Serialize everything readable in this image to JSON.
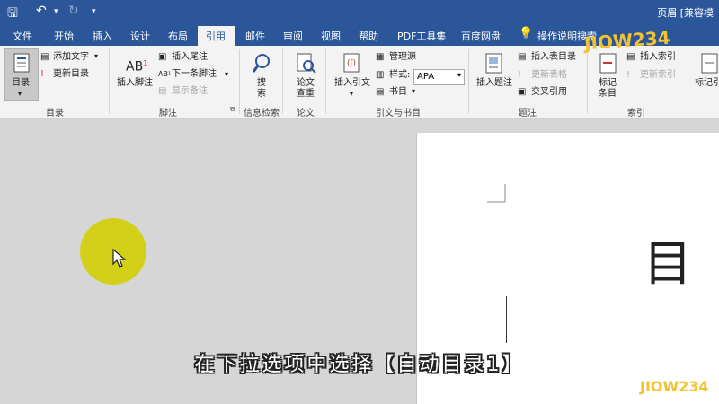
{
  "window": {
    "title": "页眉 [兼容模"
  },
  "tabs": [
    "文件",
    "开始",
    "插入",
    "设计",
    "布局",
    "引用",
    "邮件",
    "审阅",
    "视图",
    "帮助",
    "PDF工具集",
    "百度网盘"
  ],
  "active_tab": "引用",
  "tell_me": "操作说明搜索",
  "ribbon": {
    "toc": {
      "button": "目录",
      "add_text": "添加文字",
      "update": "更新目录",
      "group": "目录"
    },
    "footnotes": {
      "insert_footnote": "插入脚注",
      "insert_endnote": "插入尾注",
      "next_footnote": "下一条脚注",
      "show_notes": "显示备注",
      "group": "脚注"
    },
    "research": {
      "search": "搜索",
      "group": "信息检索"
    },
    "paper": {
      "check": "论文查重",
      "group": "论文"
    },
    "citations": {
      "insert_citation": "插入引文",
      "manage_sources": "管理源",
      "style_label": "样式:",
      "style_value": "APA",
      "bibliography": "书目",
      "group": "引文与书目"
    },
    "captions": {
      "insert_caption": "插入题注",
      "insert_table_figures": "插入表目录",
      "update_table": "更新表格",
      "cross_reference": "交叉引用",
      "group": "题注"
    },
    "index": {
      "mark_entry": "标记条目",
      "insert_index": "插入索引",
      "update_index": "更新索引",
      "group": "索引"
    },
    "toa": {
      "mark_citation": "标记引"
    }
  },
  "document": {
    "glyph": "目"
  },
  "subtitle": "在下拉选项中选择【自动目录1】",
  "watermark": "JIOW234",
  "colors": {
    "titlebar": "#2b579a",
    "halo": "#d4d01a"
  }
}
